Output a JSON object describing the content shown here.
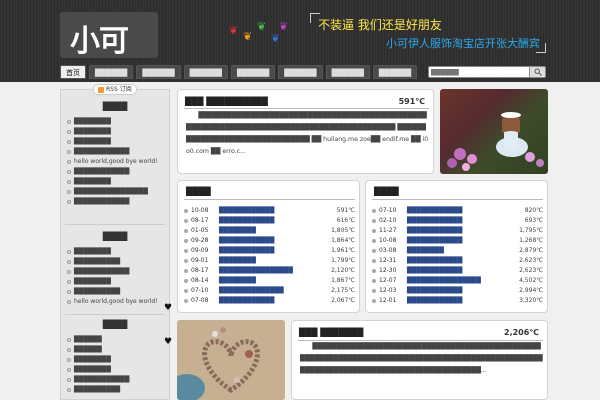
{
  "header": {
    "logo_text": "小可",
    "slogan_line1": "不装逼 我们还是好朋友",
    "slogan_line2": "小可伊人服饰淘宝店开张大酬宾",
    "paw_icons": [
      "paw-red",
      "paw-yellow",
      "paw-green",
      "paw-blue"
    ],
    "colors": {
      "slogan1": "#ffe84a",
      "slogan2": "#2aa8ea"
    }
  },
  "nav": {
    "items": [
      "首页",
      "██████",
      "██████",
      "██████",
      "██████",
      "██████",
      "██████",
      "██████"
    ]
  },
  "search": {
    "placeholder": "██████"
  },
  "sidebar": {
    "rss_label": "RSS 订阅",
    "sections": [
      {
        "title": "████",
        "items": [
          "████████",
          "████████",
          "████████",
          "████████████",
          "hello world,good bye world!",
          "████████████",
          "████████",
          "████████████████",
          "████████████"
        ]
      },
      {
        "title": "████",
        "items": [
          "████████",
          "██████████",
          "████████████",
          "████████",
          "██████████",
          "hello world,good bye world!"
        ]
      },
      {
        "title": "████",
        "items": [
          "██████",
          "██████",
          "████████",
          "████████",
          "████████████",
          "██████████"
        ]
      }
    ]
  },
  "post1": {
    "title": "███ ██████████",
    "count": "591℃",
    "body": "　　████████████████████████████████████████████████████████████████████████████████████████████ ████████████████████████████████ ██ huilang.me zoe██ endif.me ██ i0o0.com ██ erro.c..."
  },
  "list_left": {
    "title": "████",
    "rows": [
      {
        "date": "10-08",
        "title": "████████████",
        "value": "591℃"
      },
      {
        "date": "08-17",
        "title": "████████████",
        "value": "616℃"
      },
      {
        "date": "01-05",
        "title": "████████",
        "value": "1,805℃"
      },
      {
        "date": "09-28",
        "title": "████████████",
        "value": "1,864℃"
      },
      {
        "date": "09-09",
        "title": "████████████",
        "value": "1,961℃"
      },
      {
        "date": "09-01",
        "title": "████████",
        "value": "1,799℃"
      },
      {
        "date": "08-17",
        "title": "████████████████",
        "value": "2,120℃"
      },
      {
        "date": "08-14",
        "title": "████████",
        "value": "1,867℃"
      },
      {
        "date": "07-10",
        "title": "██████████████",
        "value": "2,175℃"
      },
      {
        "date": "07-08",
        "title": "████████████",
        "value": "2,067℃"
      }
    ]
  },
  "list_right": {
    "title": "████",
    "rows": [
      {
        "date": "07-10",
        "title": "████████████",
        "value": "820℃"
      },
      {
        "date": "02-10",
        "title": "████████████",
        "value": "693℃"
      },
      {
        "date": "11-27",
        "title": "████████████",
        "value": "1,795℃"
      },
      {
        "date": "10-08",
        "title": "████████████",
        "value": "1,268℃"
      },
      {
        "date": "03-08",
        "title": "████████",
        "value": "2,879℃"
      },
      {
        "date": "12-31",
        "title": "████████████",
        "value": "2,623℃"
      },
      {
        "date": "12-30",
        "title": "████████████",
        "value": "2,623℃"
      },
      {
        "date": "12-07",
        "title": "████████████████",
        "value": "4,502℃"
      },
      {
        "date": "12-03",
        "title": "████████████",
        "value": "2,994℃"
      },
      {
        "date": "12-01",
        "title": "████████████",
        "value": "3,320℃"
      }
    ]
  },
  "post2": {
    "title": "███ ███████",
    "count": "2,206℃",
    "body": "　　█████████████████████████████████████████████████████████████████████████████████████████████████████████████████████████████████████████..."
  }
}
